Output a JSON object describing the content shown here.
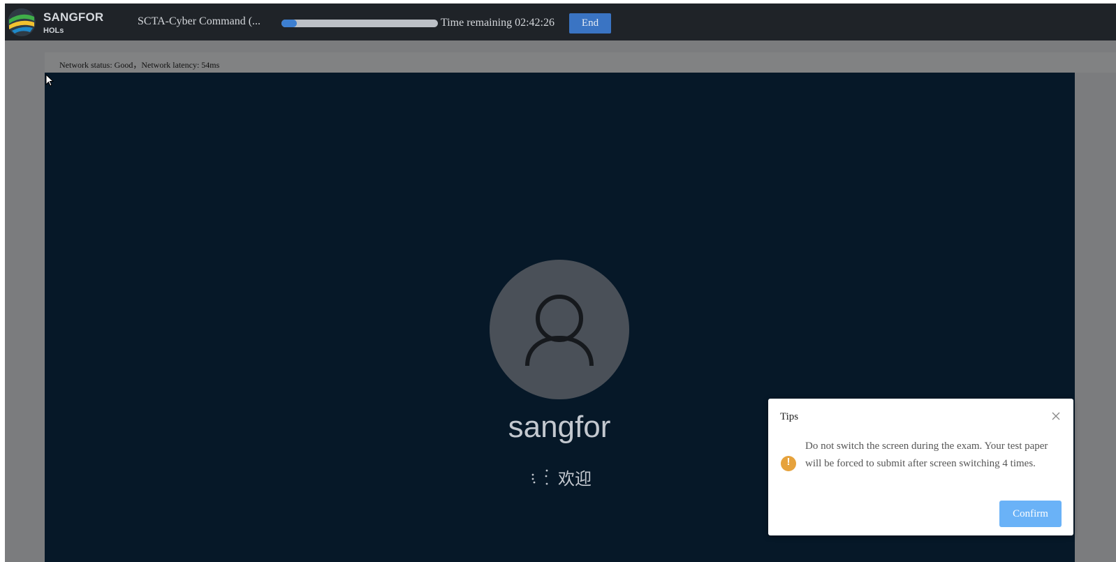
{
  "header": {
    "brand_name": "SANGFOR",
    "brand_sub": "HOLs",
    "exam_title": "SCTA-Cyber Command (...",
    "progress_fraction": 0.1,
    "time_remaining": "Time remaining 02:42:26",
    "end_label": "End"
  },
  "status": {
    "network": "Network status: Good，Network latency: 54ms"
  },
  "remote_screen": {
    "username": "sangfor",
    "welcome": "欢迎",
    "avatar_icon": "user-icon",
    "spinner_icon": "loading-spinner-icon"
  },
  "tips_dialog": {
    "title": "Tips",
    "message": "Do not switch the screen during the exam. Your test paper will be forced to submit after screen switching 4 times.",
    "confirm_label": "Confirm",
    "warning_icon": "warning-icon",
    "warning_symbol": "!",
    "close_icon": "close-icon"
  },
  "colors": {
    "topbar": "#1f2328",
    "remote_bg": "#061828",
    "accent_button": "#3a74c3",
    "confirm_button": "#6ab2f7",
    "warning": "#e6a23c"
  }
}
